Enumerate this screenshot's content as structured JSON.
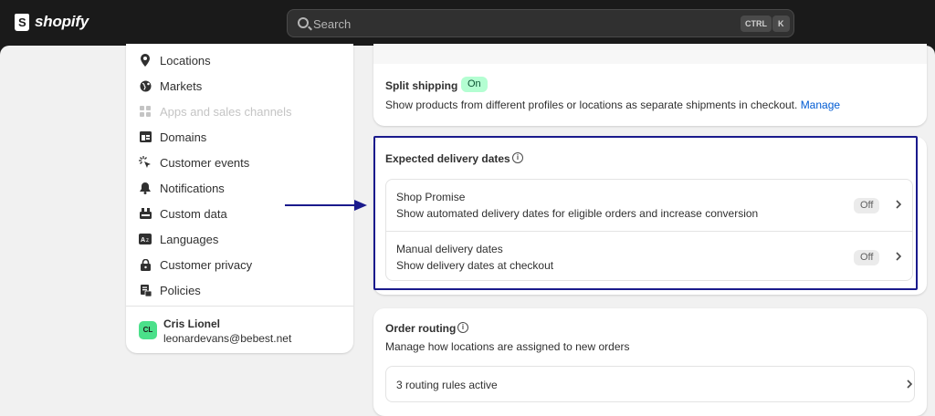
{
  "topbar": {
    "brand": "shopify",
    "search_placeholder": "Search",
    "shortcut_ctrl": "CTRL",
    "shortcut_k": "K"
  },
  "sidebar": {
    "items": [
      {
        "label": "Locations",
        "icon": "location-pin-icon"
      },
      {
        "label": "Markets",
        "icon": "globe-icon"
      },
      {
        "label": "Apps and sales channels",
        "icon": "apps-icon",
        "disabled": true
      },
      {
        "label": "Domains",
        "icon": "domain-icon"
      },
      {
        "label": "Customer events",
        "icon": "cursor-click-icon"
      },
      {
        "label": "Notifications",
        "icon": "bell-icon"
      },
      {
        "label": "Custom data",
        "icon": "database-icon"
      },
      {
        "label": "Languages",
        "icon": "language-icon"
      },
      {
        "label": "Customer privacy",
        "icon": "lock-icon"
      },
      {
        "label": "Policies",
        "icon": "policy-icon"
      }
    ],
    "user": {
      "initials": "CL",
      "name": "Cris Lionel",
      "email": "leonardevans@bebest.net"
    }
  },
  "split_shipping": {
    "title": "Split shipping",
    "status": "On",
    "description": "Show products from different profiles or locations as separate shipments in checkout.",
    "manage_link": "Manage"
  },
  "expected_delivery": {
    "title": "Expected delivery dates",
    "rows": [
      {
        "title": "Shop Promise",
        "description": "Show automated delivery dates for eligible orders and increase conversion",
        "status": "Off"
      },
      {
        "title": "Manual delivery dates",
        "description": "Show delivery dates at checkout",
        "status": "Off"
      }
    ]
  },
  "order_routing": {
    "title": "Order routing",
    "description": "Manage how locations are assigned to new orders",
    "rules": "3 routing rules active"
  },
  "colors": {
    "topbar": "#1a1a1a",
    "on_badge": "#b4fed2",
    "highlight_border": "#1a1a8c",
    "arrow": "#1a1a8c",
    "link": "#005bd3"
  }
}
